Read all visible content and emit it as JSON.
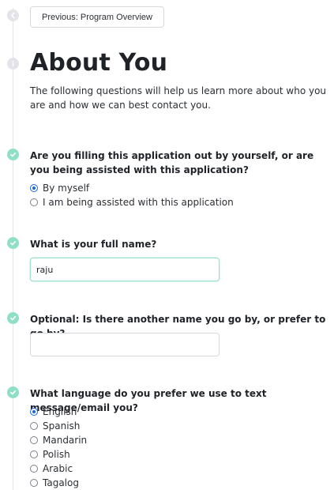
{
  "nav": {
    "previous_label": "Previous: Program Overview"
  },
  "page": {
    "title": "About You",
    "intro": "The following questions will help us learn more about who you are and how we can best contact you."
  },
  "questions": {
    "assisted": {
      "prompt": "Are you filling this application out by yourself, or are you being assisted with this application?",
      "options": [
        "By myself",
        "I am being assisted with this application"
      ],
      "selected": "By myself"
    },
    "full_name": {
      "prompt": "What is your full name?",
      "value": "raju"
    },
    "other_name": {
      "prompt": "Optional: Is there another name you go by, or prefer to go by?",
      "value": ""
    },
    "language": {
      "prompt": "What language do you prefer we use to text message/email you?",
      "options": [
        "English",
        "Spanish",
        "Mandarin",
        "Polish",
        "Arabic",
        "Tagalog"
      ],
      "selected": "English"
    }
  },
  "colors": {
    "accent_green": "#8fe0c2",
    "radio_blue": "#1a66e0",
    "rail_grey": "#e3e5e8"
  }
}
